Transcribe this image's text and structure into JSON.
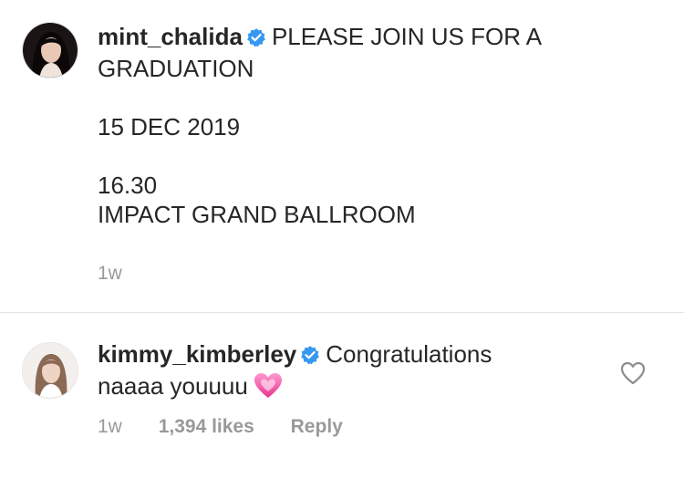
{
  "post": {
    "username": "mint_chalida",
    "caption_line1": "PLEASE JOIN US FOR A",
    "caption_rest": "GRADUATION\n\n15 DEC 2019\n\n16.30\nIMPACT GRAND BALLROOM",
    "time": "1w"
  },
  "comment": {
    "username": "kimmy_kimberley",
    "text_line1": "Congratulations",
    "text_line2": "naaaa youuuu",
    "emoji": "pink-heart",
    "time": "1w",
    "likes": "1,394 likes",
    "reply_label": "Reply"
  },
  "colors": {
    "text": "#262626",
    "meta": "#999999",
    "verified": "#3897f0",
    "divider": "#e4e4e4"
  }
}
